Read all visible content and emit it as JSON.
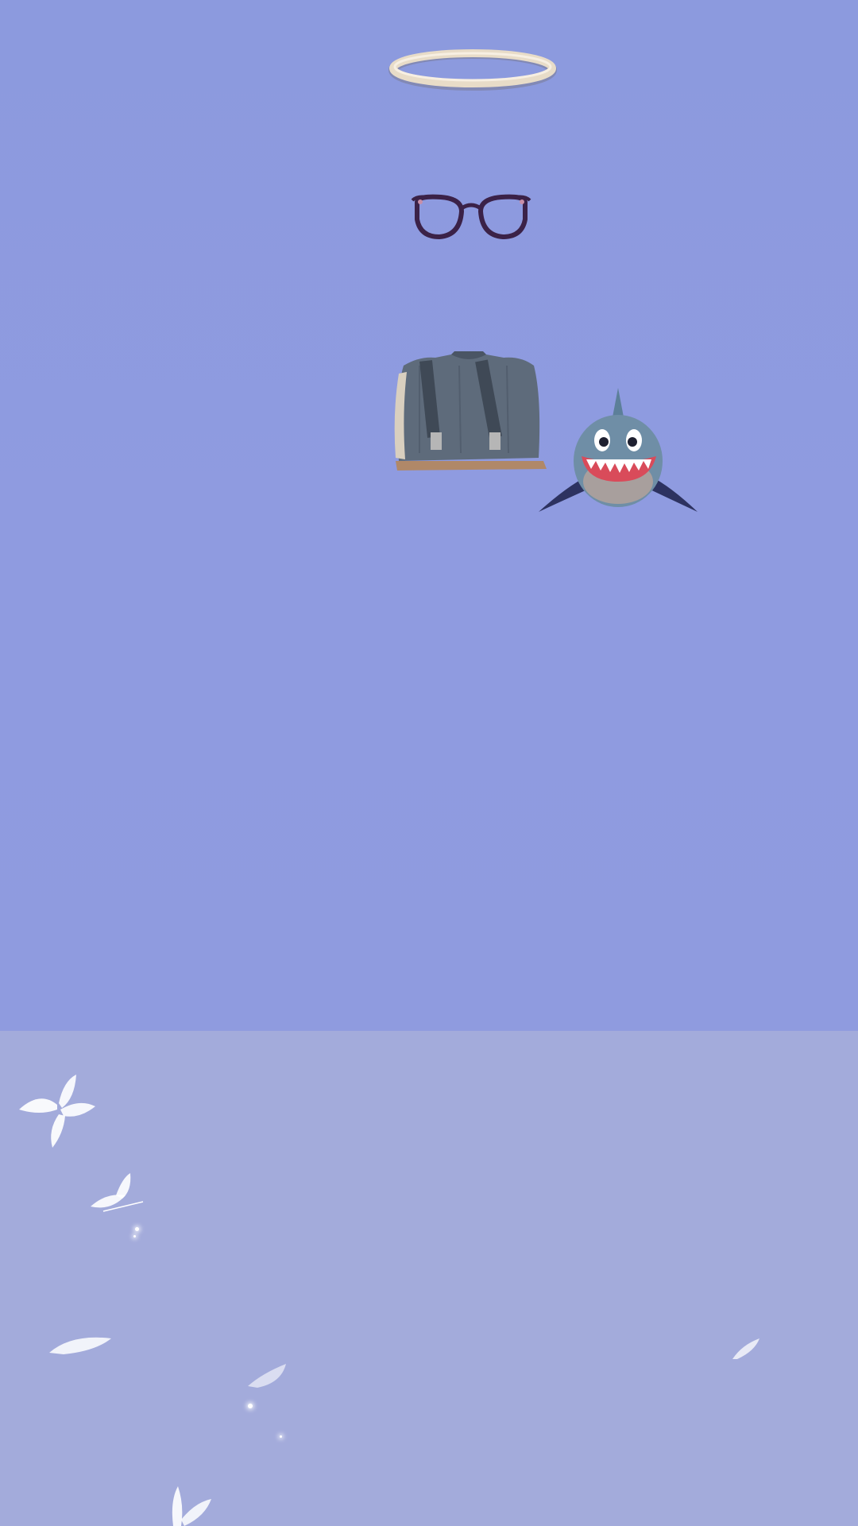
{
  "scene": {
    "sky_color": "#8f9bdf",
    "panel_color": "#a3abdb",
    "accessories": [
      {
        "name": "halo-icon"
      },
      {
        "name": "glasses-icon"
      },
      {
        "name": "suspenders-vest-icon"
      },
      {
        "name": "shark-pet-icon"
      }
    ],
    "particles": [
      "butterfly-icon",
      "feather-icon",
      "sparkle-icon"
    ]
  }
}
